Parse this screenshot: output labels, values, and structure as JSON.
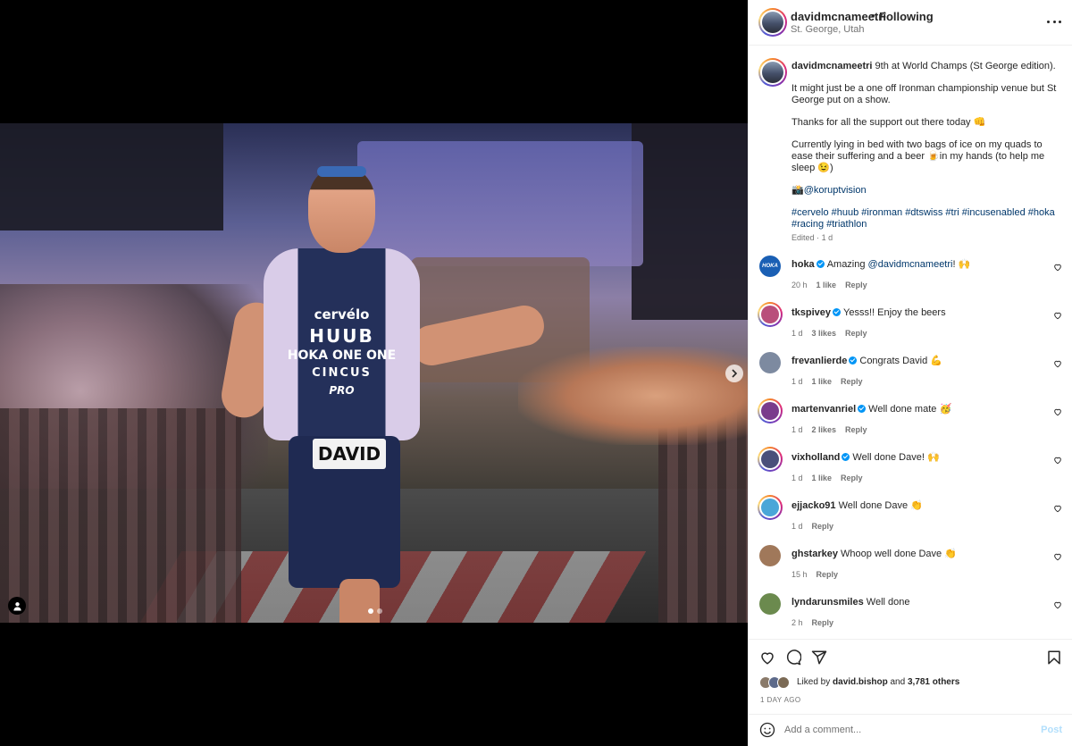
{
  "post": {
    "username": "davidmcnameetri",
    "separator": "•",
    "follow_status": "Following",
    "location": "St. George, Utah",
    "bib_name": "DAVID",
    "kit_logos": [
      "cervélo",
      "HUUB",
      "HOKA ONE ONE",
      "CINCUS",
      "PRO"
    ],
    "carousel_count": 2,
    "carousel_index": 1
  },
  "caption": {
    "username": "davidmcnameetri",
    "line1": "9th at World Champs (St George edition).",
    "para2": "It might just be a one off Ironman championship venue but St George put on a show.",
    "para3": "Thanks for all the support out there today 👊",
    "para4": "Currently lying in bed with two bags of ice on my quads to ease their suffering and a beer 🍺in my hands (to help me sleep 😉)",
    "para5_prefix": "📸",
    "para5_mention": "@koruptvision",
    "hashtags": "#cervelo #huub #ironman #dtswiss #tri #incusenabled #hoka #racing #triathlon",
    "edited": "Edited",
    "edited_sep": "·",
    "edited_time": "1 d"
  },
  "comments": [
    {
      "user": "hoka",
      "verified": true,
      "text_prefix": "Amazing ",
      "mention": "@davidmcnameetri",
      "text_suffix": "! 🙌",
      "time": "20 h",
      "likes": "1 like",
      "reply": "Reply",
      "avatar_color": "#1a5fb4",
      "avatar_text": "HOKA",
      "ringed": false
    },
    {
      "user": "tkspivey",
      "verified": true,
      "text_prefix": "Yesss!! Enjoy the beers",
      "mention": "",
      "text_suffix": "",
      "time": "1 d",
      "likes": "3 likes",
      "reply": "Reply",
      "avatar_color": "#b94f7b",
      "avatar_text": "",
      "ringed": true
    },
    {
      "user": "frevanlierde",
      "verified": true,
      "text_prefix": "Congrats David 💪",
      "mention": "",
      "text_suffix": "",
      "time": "1 d",
      "likes": "1 like",
      "reply": "Reply",
      "avatar_color": "#7d8aa0",
      "avatar_text": "",
      "ringed": false
    },
    {
      "user": "martenvanriel",
      "verified": true,
      "text_prefix": "Well done mate 🥳",
      "mention": "",
      "text_suffix": "",
      "time": "1 d",
      "likes": "2 likes",
      "reply": "Reply",
      "avatar_color": "#7a3c8c",
      "avatar_text": "",
      "ringed": true
    },
    {
      "user": "vixholland",
      "verified": true,
      "text_prefix": "Well done Dave! 🙌",
      "mention": "",
      "text_suffix": "",
      "time": "1 d",
      "likes": "1 like",
      "reply": "Reply",
      "avatar_color": "#4a4f7a",
      "avatar_text": "",
      "ringed": true
    },
    {
      "user": "ejjacko91",
      "verified": false,
      "text_prefix": "Well done Dave 👏",
      "mention": "",
      "text_suffix": "",
      "time": "1 d",
      "likes": "",
      "reply": "Reply",
      "avatar_color": "#4aa6d8",
      "avatar_text": "",
      "ringed": true
    },
    {
      "user": "ghstarkey",
      "verified": false,
      "text_prefix": "Whoop well done Dave 👏",
      "mention": "",
      "text_suffix": "",
      "time": "15 h",
      "likes": "",
      "reply": "Reply",
      "avatar_color": "#a0785a",
      "avatar_text": "",
      "ringed": false
    },
    {
      "user": "lyndarunsmiles",
      "verified": false,
      "text_prefix": "Well done",
      "mention": "",
      "text_suffix": "",
      "time": "2 h",
      "likes": "",
      "reply": "Reply",
      "avatar_color": "#6b8a4e",
      "avatar_text": "",
      "ringed": false
    }
  ],
  "actions": {
    "liked_prefix": "Liked by ",
    "liked_user": "david.bishop",
    "liked_middle": " and ",
    "liked_count": "3,781 others",
    "posted_ago": "1 DAY AGO"
  },
  "add_comment": {
    "placeholder": "Add a comment...",
    "post_label": "Post"
  },
  "colors": {
    "link": "#00376b",
    "verified": "#0095f6",
    "post_button_disabled": "#b2dffc",
    "muted": "#737373"
  },
  "icons": [
    "tag-user-icon",
    "carousel-next-icon",
    "more-options-icon",
    "verified-icon",
    "heart-icon",
    "comment-icon",
    "share-icon",
    "bookmark-icon",
    "emoji-icon"
  ]
}
